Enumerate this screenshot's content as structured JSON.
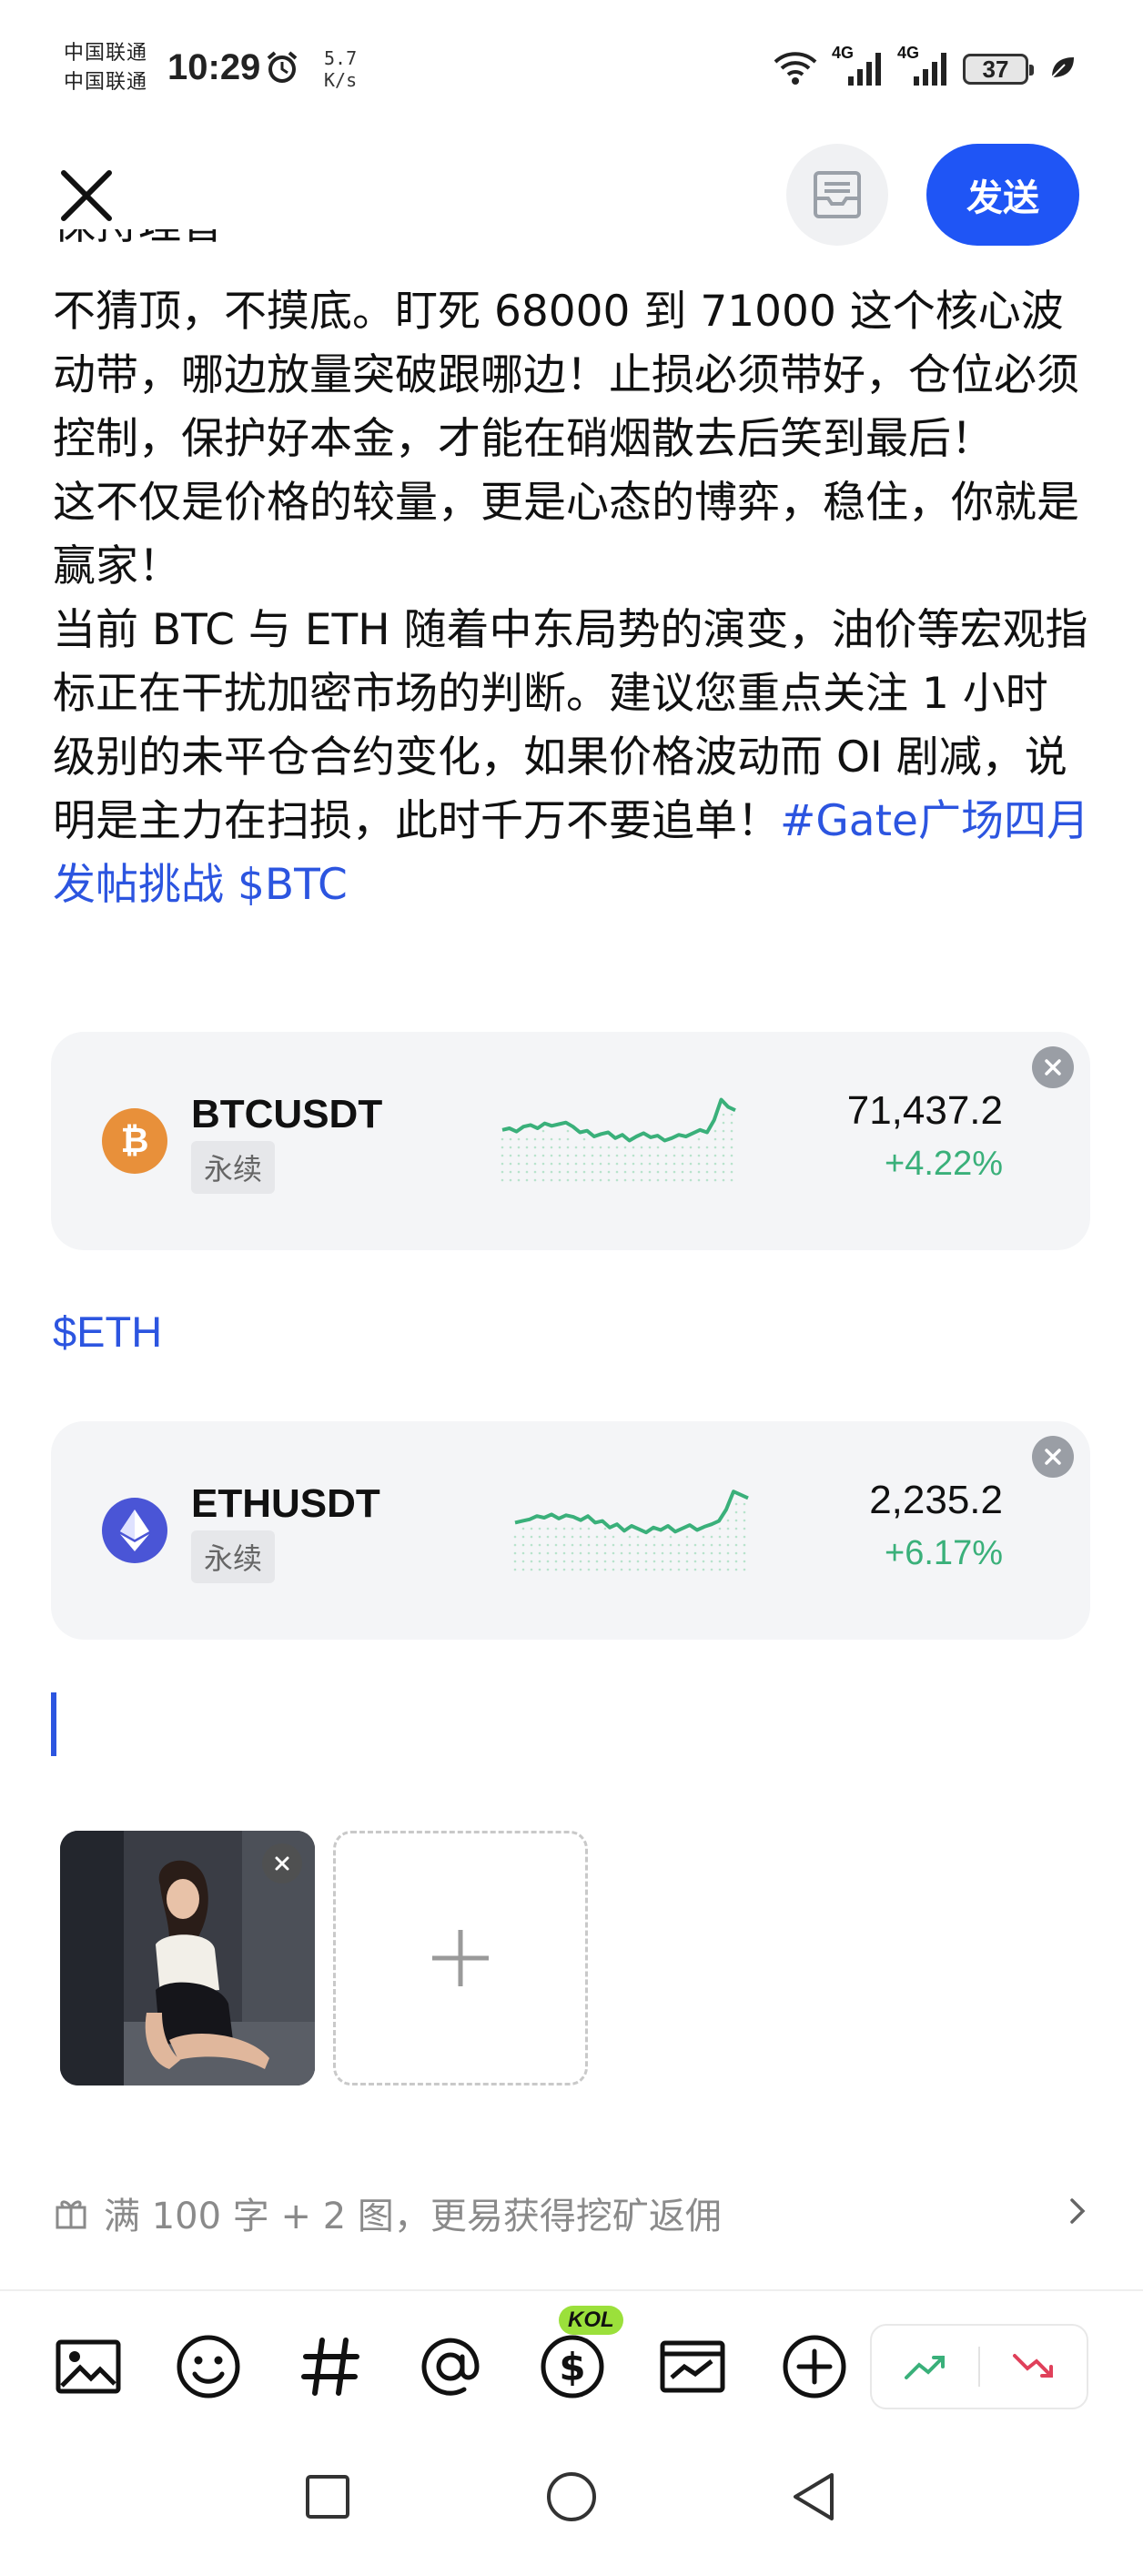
{
  "status_bar": {
    "carrier_1": "中国联通",
    "carrier_2": "中国联通",
    "time": "10:29",
    "speed_value": "5.7",
    "speed_unit": "K/s",
    "network_1": "4G",
    "network_2": "4G",
    "battery": "37"
  },
  "header": {
    "send_label": "发送"
  },
  "post": {
    "cut_line": "保持理智",
    "paragraphs": [
      "不猜顶，不摸底。盯死 68000 到 71000 这个核心波动带，哪边放量突破跟哪边！止损必须带好，仓位必须控制，保护好本金，才能在硝烟散去后笑到最后！",
      "这不仅是价格的较量，更是心态的博弈，稳住，你就是赢家！",
      "当前 BTC 与 ETH 随着中东局势的演变，油价等宏观指标正在干扰加密市场的判断。建议您重点关注 1 小时级别的未平仓合约变化，如果价格波动而 OI 剧减，说明是主力在扫损，此时千万不要追单！"
    ],
    "hashtag": "#Gate广场四月发帖挑战",
    "cashtag": "$BTC",
    "eth_tag": "$ETH"
  },
  "cards": [
    {
      "pair": "BTCUSDT",
      "tag": "永续",
      "price": "71,437.2",
      "change": "+4.22%",
      "icon": "bitcoin-icon",
      "icon_color": "#e8903a",
      "spark": [
        0.42,
        0.4,
        0.44,
        0.38,
        0.36,
        0.4,
        0.34,
        0.37,
        0.35,
        0.33,
        0.38,
        0.45,
        0.43,
        0.5,
        0.47,
        0.45,
        0.52,
        0.48,
        0.55,
        0.5,
        0.46,
        0.51,
        0.49,
        0.55,
        0.52,
        0.48,
        0.5,
        0.46,
        0.42,
        0.45,
        0.3,
        0.05,
        0.14,
        0.18
      ]
    },
    {
      "pair": "ETHUSDT",
      "tag": "永续",
      "price": "2,235.2",
      "change": "+6.17%",
      "icon": "ethereum-icon",
      "icon_color": "#4a55d6",
      "spark": [
        0.46,
        0.44,
        0.42,
        0.38,
        0.4,
        0.36,
        0.41,
        0.37,
        0.39,
        0.43,
        0.38,
        0.46,
        0.44,
        0.52,
        0.48,
        0.56,
        0.5,
        0.54,
        0.58,
        0.52,
        0.55,
        0.5,
        0.57,
        0.53,
        0.49,
        0.55,
        0.51,
        0.48,
        0.44,
        0.3,
        0.08,
        0.12,
        0.16
      ]
    }
  ],
  "reward": {
    "text": "满 100 字 + 2 图，更易获得挖矿返佣"
  },
  "toolbar": {
    "kol_badge": "KOL"
  },
  "colors": {
    "accent": "#1f55f5",
    "link": "#2c55e0",
    "up": "#3ab07a",
    "down": "#e0405a"
  }
}
